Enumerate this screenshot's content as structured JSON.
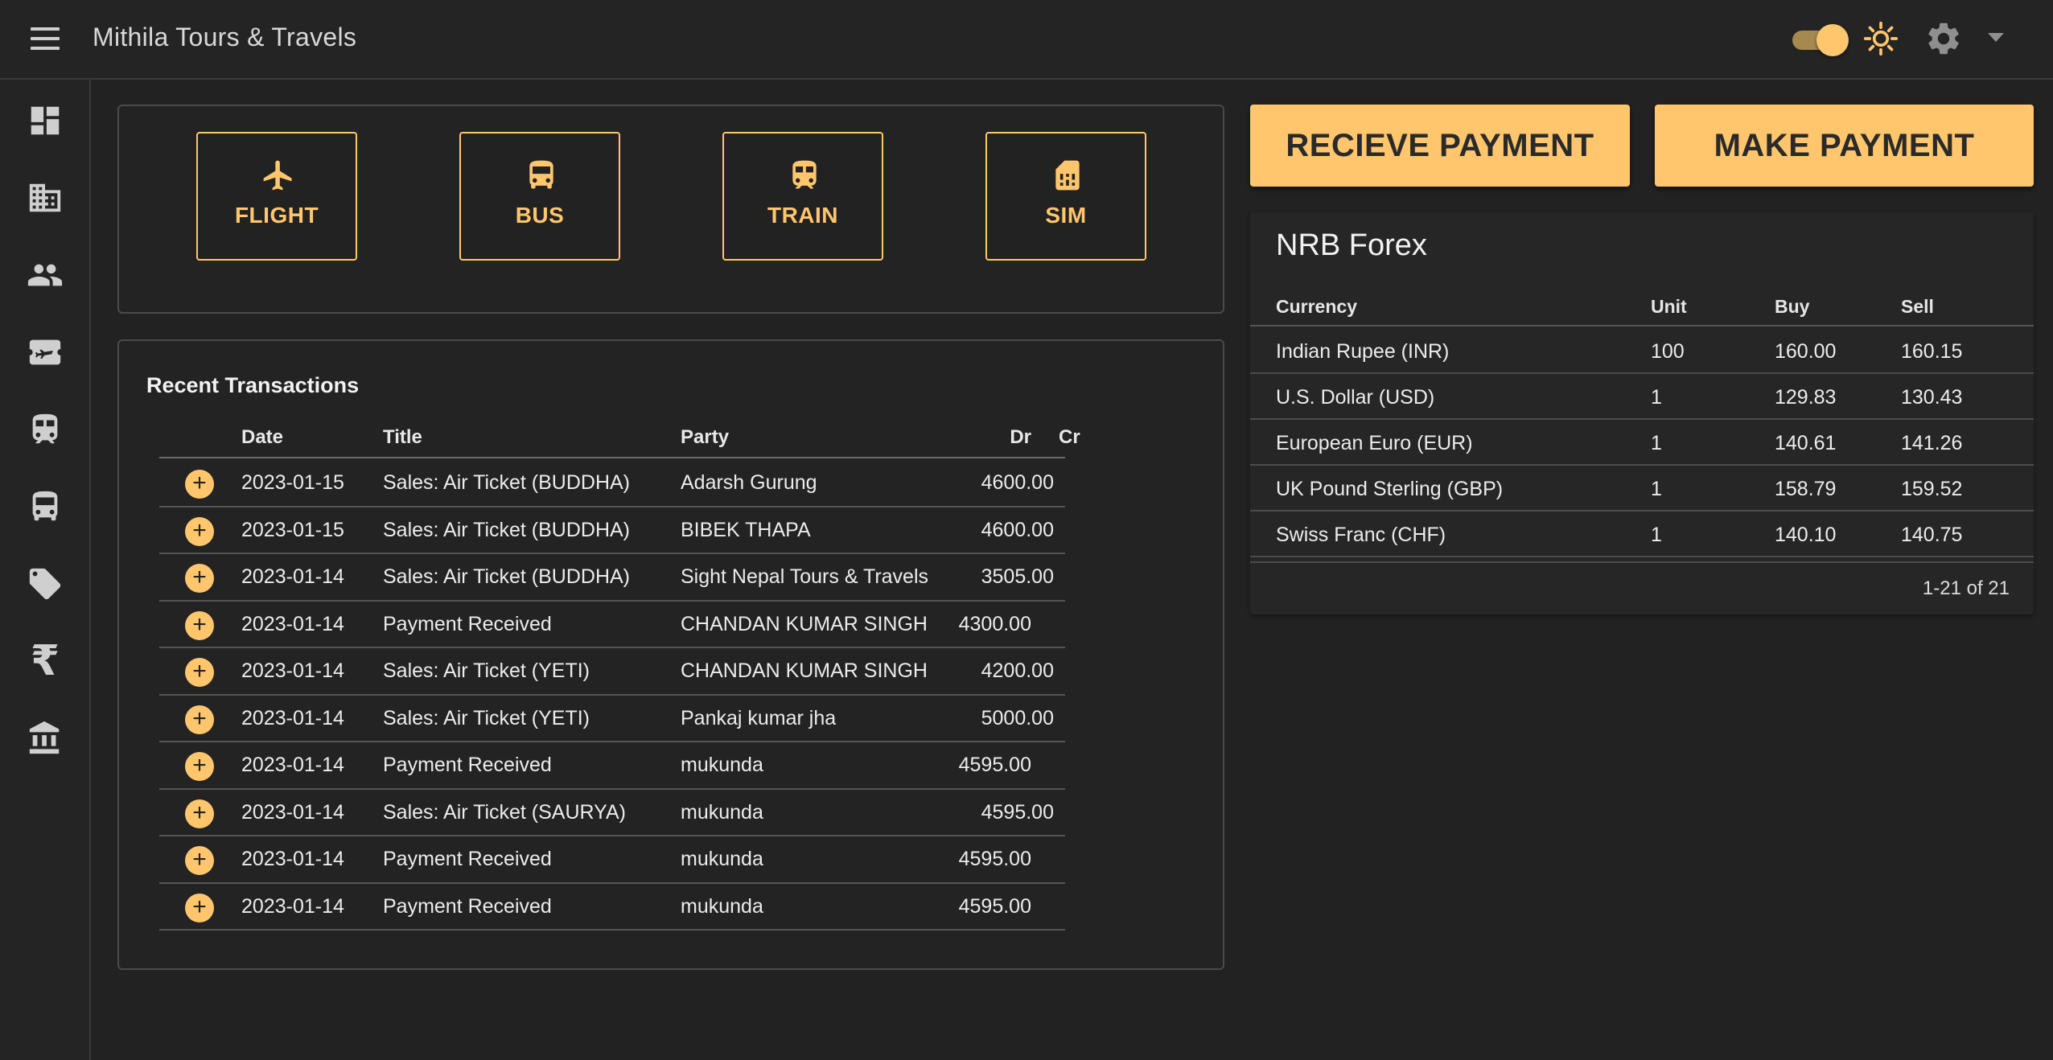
{
  "app": {
    "title": "Mithila Tours & Travels"
  },
  "header_icons": [
    "menu-icon",
    "theme-toggle",
    "sun-icon",
    "gear-icon",
    "caret-down-icon"
  ],
  "sidebar": {
    "items": [
      {
        "name": "dashboard",
        "icon": "dashboard-icon"
      },
      {
        "name": "company",
        "icon": "building-icon"
      },
      {
        "name": "people",
        "icon": "people-icon"
      },
      {
        "name": "airline-ticket",
        "icon": "ticket-icon"
      },
      {
        "name": "train",
        "icon": "train-icon"
      },
      {
        "name": "bus",
        "icon": "bus-icon"
      },
      {
        "name": "tags",
        "icon": "tag-icon"
      },
      {
        "name": "currency",
        "icon": "rupee-icon",
        "glyph": "₹"
      },
      {
        "name": "bank",
        "icon": "bank-icon"
      }
    ]
  },
  "services": {
    "flight": "FLIGHT",
    "bus": "BUS",
    "train": "TRAIN",
    "sim": "SIM"
  },
  "actions": {
    "receive": "RECIEVE PAYMENT",
    "make": "MAKE PAYMENT"
  },
  "transactions": {
    "title": "Recent Transactions",
    "columns": {
      "date": "Date",
      "title": "Title",
      "party": "Party",
      "dr": "Dr",
      "cr": "Cr"
    },
    "add_glyph": "+",
    "rows": [
      {
        "date": "2023-01-15",
        "title": "Sales: Air Ticket (BUDDHA)",
        "party": "Adarsh Gurung",
        "dr": "",
        "cr": "4600.00"
      },
      {
        "date": "2023-01-15",
        "title": "Sales: Air Ticket (BUDDHA)",
        "party": "BIBEK THAPA",
        "dr": "",
        "cr": "4600.00"
      },
      {
        "date": "2023-01-14",
        "title": "Sales: Air Ticket (BUDDHA)",
        "party": "Sight Nepal Tours & Travels",
        "dr": "",
        "cr": "3505.00"
      },
      {
        "date": "2023-01-14",
        "title": "Payment Received",
        "party": "CHANDAN KUMAR SINGH",
        "dr": "4300.00",
        "cr": ""
      },
      {
        "date": "2023-01-14",
        "title": "Sales: Air Ticket (YETI)",
        "party": "CHANDAN KUMAR SINGH",
        "dr": "",
        "cr": "4200.00"
      },
      {
        "date": "2023-01-14",
        "title": "Sales: Air Ticket (YETI)",
        "party": "Pankaj kumar jha",
        "dr": "",
        "cr": "5000.00"
      },
      {
        "date": "2023-01-14",
        "title": "Payment Received",
        "party": "mukunda",
        "dr": "4595.00",
        "cr": ""
      },
      {
        "date": "2023-01-14",
        "title": "Sales: Air Ticket (SAURYA)",
        "party": "mukunda",
        "dr": "",
        "cr": "4595.00"
      },
      {
        "date": "2023-01-14",
        "title": "Payment Received",
        "party": "mukunda",
        "dr": "4595.00",
        "cr": ""
      },
      {
        "date": "2023-01-14",
        "title": "Payment Received",
        "party": "mukunda",
        "dr": "4595.00",
        "cr": ""
      }
    ]
  },
  "forex": {
    "title": "NRB Forex",
    "columns": {
      "currency": "Currency",
      "unit": "Unit",
      "buy": "Buy",
      "sell": "Sell"
    },
    "rows": [
      {
        "currency": "Indian Rupee (INR)",
        "unit": "100",
        "buy": "160.00",
        "sell": "160.15"
      },
      {
        "currency": "U.S. Dollar (USD)",
        "unit": "1",
        "buy": "129.83",
        "sell": "130.43"
      },
      {
        "currency": "European Euro (EUR)",
        "unit": "1",
        "buy": "140.61",
        "sell": "141.26"
      },
      {
        "currency": "UK Pound Sterling (GBP)",
        "unit": "1",
        "buy": "158.79",
        "sell": "159.52"
      },
      {
        "currency": "Swiss Franc (CHF)",
        "unit": "1",
        "buy": "140.10",
        "sell": "140.75"
      }
    ],
    "pagination": "1-21 of 21"
  },
  "colors": {
    "accent": "#ffc66d",
    "background": "#222222",
    "surface": "#262626",
    "border": "#4a4a4a",
    "text": "#ececec"
  }
}
